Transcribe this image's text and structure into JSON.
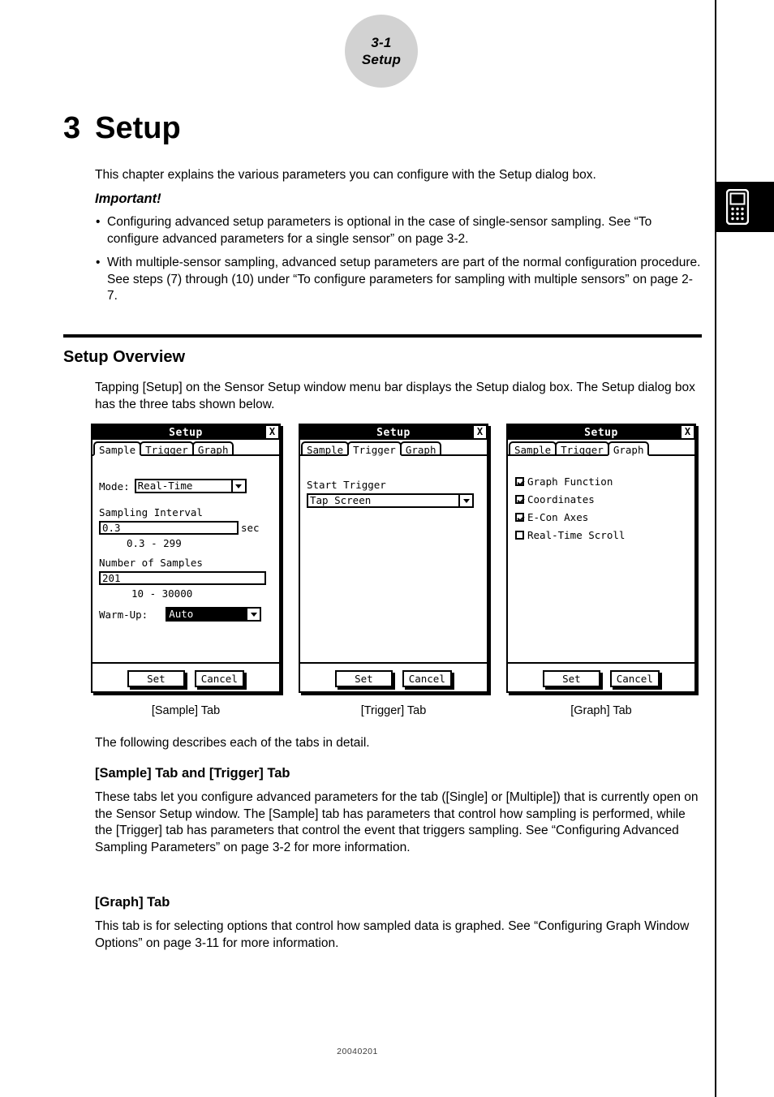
{
  "page": {
    "corner_badge": {
      "line1": "3-1",
      "line2": "Setup"
    },
    "footer": "20040201",
    "thumb_icon": "calculator-icon"
  },
  "chapter": {
    "number": "3",
    "title": "Setup",
    "intro": "This chapter explains the various parameters you can configure with the Setup dialog box.",
    "important_label": "Important!",
    "bullets": [
      "Configuring advanced setup parameters is optional in the case of single-sensor sampling. See “To configure advanced parameters for a single sensor” on page 3-2.",
      "With multiple-sensor sampling, advanced setup parameters are part of the normal configuration procedure. See steps (7) through (10) under “To configure parameters for sampling with multiple sensors” on page 2-7."
    ],
    "bullet_marker": "•"
  },
  "overview": {
    "heading": "Setup Overview",
    "paragraph": "Tapping [Setup] on the Sensor Setup window menu bar displays the Setup dialog box. The Setup dialog box has the three tabs shown below.",
    "following_paragraph": "The following describes each of the tabs in detail."
  },
  "captions": {
    "sample": "[Sample] Tab",
    "trigger": "[Trigger] Tab",
    "graph": "[Graph] Tab"
  },
  "sections": [
    {
      "heading": "[Sample] Tab and [Trigger] Tab",
      "body": "These tabs let you configure advanced parameters for the tab ([Single] or [Multiple]) that is currently open on the Sensor Setup window. The [Sample] tab has parameters that control how sampling is performed, while the [Trigger] tab has parameters that control the event that triggers sampling. See “Configuring Advanced Sampling Parameters” on page 3-2 for more information."
    },
    {
      "heading": "[Graph] Tab",
      "body": "This tab is for selecting options that control how sampled data is graphed. See “Configuring Graph Window Options” on page 3-11 for more information."
    }
  ],
  "dialog": {
    "title": "Setup",
    "close_label": "X",
    "tabs": [
      "Sample",
      "Trigger",
      "Graph"
    ],
    "buttons": {
      "set": "Set",
      "cancel": "Cancel"
    }
  },
  "sample_tab": {
    "mode_label": "Mode:",
    "mode_value": "Real-Time",
    "sampling_interval_label": "Sampling Interval",
    "sampling_interval_value": "0.3",
    "sampling_interval_unit": "sec",
    "sampling_interval_range": "0.3 - 299",
    "number_of_samples_label": "Number of Samples",
    "number_of_samples_value": "201",
    "number_of_samples_range": "10 - 30000",
    "warm_up_label": "Warm-Up:",
    "warm_up_value": "Auto"
  },
  "trigger_tab": {
    "start_trigger_label": "Start Trigger",
    "start_trigger_value": "Tap Screen"
  },
  "graph_tab": {
    "options": [
      {
        "label": "Graph Function",
        "checked": true
      },
      {
        "label": "Coordinates",
        "checked": true
      },
      {
        "label": "E-Con Axes",
        "checked": true
      },
      {
        "label": "Real-Time Scroll",
        "checked": false
      }
    ]
  }
}
